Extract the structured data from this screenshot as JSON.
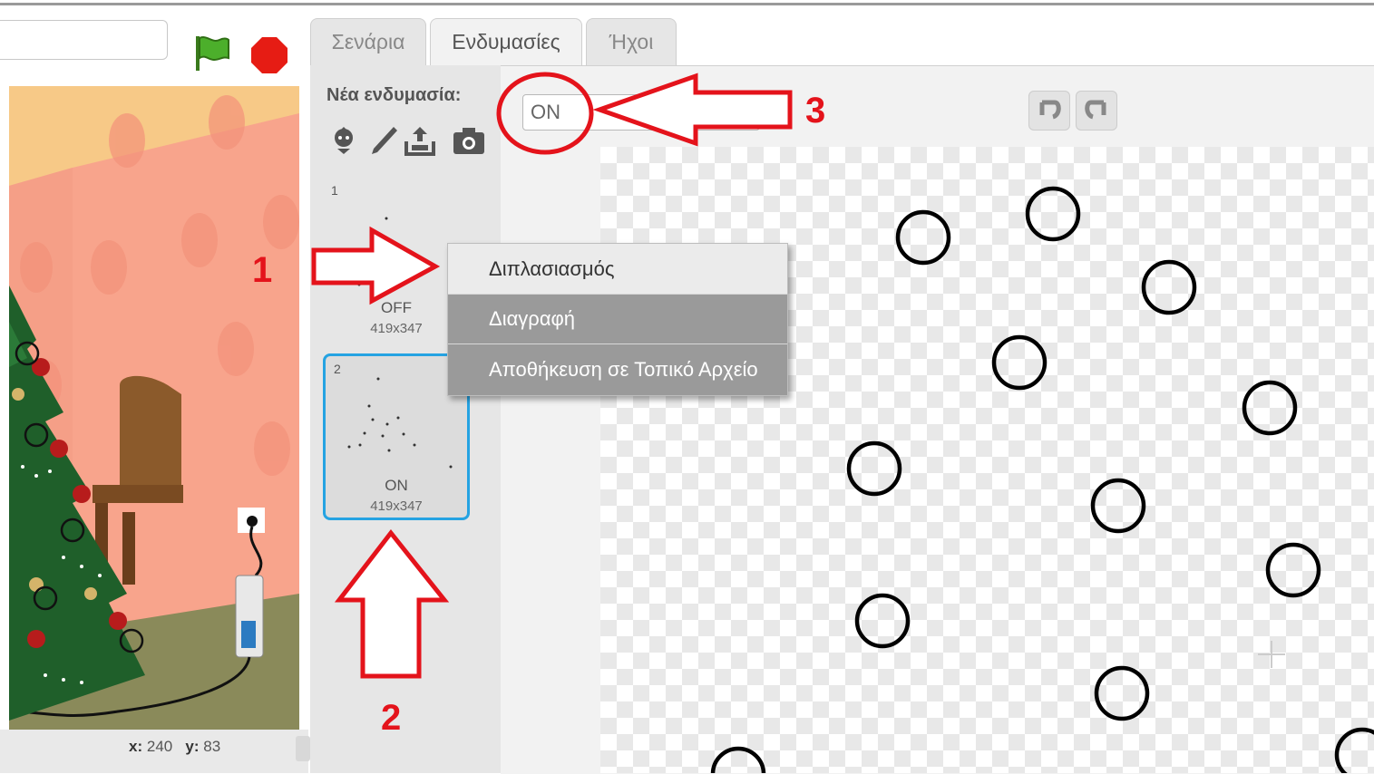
{
  "tabs": {
    "scripts": "Σενάρια",
    "costumes": "Ενδυμασίες",
    "sounds": "Ήχοι"
  },
  "costume_panel": {
    "new_costume_label": "Νέα ενδυμασία:",
    "costumes": [
      {
        "index": "1",
        "name": "OFF",
        "size": "419x347"
      },
      {
        "index": "2",
        "name": "ON",
        "size": "419x347"
      }
    ]
  },
  "editor": {
    "costume_name_value": "ON"
  },
  "context_menu": {
    "items": [
      "Διπλασιασμός",
      "Διαγραφή",
      "Αποθήκευση σε Τοπικό Αρχείο"
    ]
  },
  "stage": {
    "x_label": "x:",
    "x_value": "240",
    "y_label": "y:",
    "y_value": "83"
  },
  "annotations": {
    "step1": "1",
    "step2": "2",
    "step3": "3"
  },
  "icons": [
    "green-flag-icon",
    "stop-icon",
    "choose-from-library-icon",
    "paint-brush-icon",
    "upload-icon",
    "camera-icon",
    "undo-icon",
    "redo-icon"
  ],
  "colors": {
    "accent_selected": "#25a3e2",
    "annotation_red": "#e4131b",
    "menu_highlight": "#9a9a9a"
  }
}
